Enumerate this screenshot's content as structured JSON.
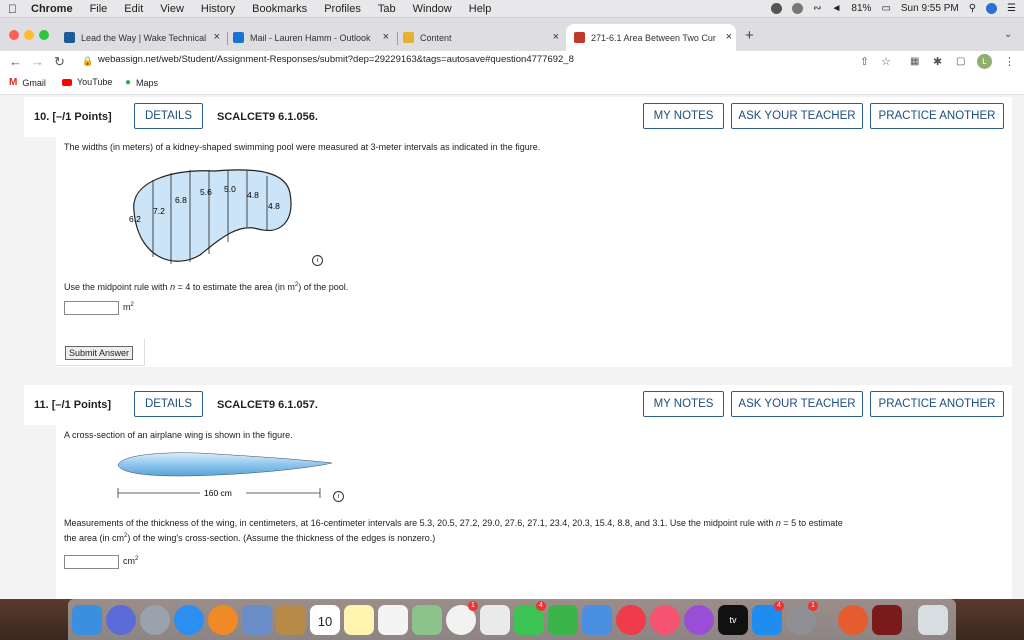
{
  "menubar": {
    "app": "Chrome",
    "items": [
      "File",
      "Edit",
      "View",
      "History",
      "Bookmarks",
      "Profiles",
      "Tab",
      "Window",
      "Help"
    ],
    "battery": "81%",
    "clock": "Sun 9:55 PM"
  },
  "tabs": [
    {
      "label": "Lead the Way | Wake Technical",
      "icon_color": "#1c5a9c"
    },
    {
      "label": "Mail - Lauren Hamm - Outlook",
      "icon_color": "#1b73d1"
    },
    {
      "label": "Content",
      "icon_color": "#e6b12e"
    },
    {
      "label": "271-6.1 Area Between Two Cur",
      "icon_color": "#c0392b"
    }
  ],
  "toolbar": {
    "url": "webassign.net/web/Student/Assignment-Responses/submit?dep=29229163&tags=autosave#question4777692_8",
    "profile_initial": "L"
  },
  "bookmarks": [
    {
      "label": "Gmail",
      "icon_color": "#d93025"
    },
    {
      "label": "YouTube",
      "icon_color": "#ff0000"
    },
    {
      "label": "Maps",
      "icon_color": "#34a853"
    }
  ],
  "q10": {
    "number": "10.",
    "points": "[–/1 Points]",
    "details": "DETAILS",
    "id": "SCALCET9 6.1.056.",
    "my_notes": "MY NOTES",
    "ask_teacher": "ASK YOUR TEACHER",
    "practice": "PRACTICE ANOTHER",
    "text": "The widths (in meters) of a kidney-shaped swimming pool were measured at 3-meter intervals as indicated in the figure.",
    "widths": [
      "6.2",
      "7.2",
      "6.8",
      "5.6",
      "5.0",
      "4.8",
      "4.8"
    ],
    "instruction_pre": "Use the midpoint rule with ",
    "n_var": "n",
    "instruction_mid": " = 4 to estimate the area (in m",
    "instruction_post": ") of the pool.",
    "unit": "m",
    "exp": "2",
    "submit": "Submit Answer"
  },
  "q11": {
    "number": "11.",
    "points": "[–/1 Points]",
    "details": "DETAILS",
    "id": "SCALCET9 6.1.057.",
    "my_notes": "MY NOTES",
    "ask_teacher": "ASK YOUR TEACHER",
    "practice": "PRACTICE ANOTHER",
    "text": "A cross-section of an airplane wing is shown in the figure.",
    "dimension": "160 cm",
    "measure_line1_pre": "Measurements of the thickness of the wing, in centimeters, at 16-centimeter intervals are 5.3, 20.5, 27.2, 29.0, 27.6, 27.1, 23.4, 20.3, 15.4, 8.8, and 3.1. Use the midpoint rule with ",
    "n_var": "n",
    "measure_line1_post": " = 5 to estimate",
    "measure_line2_pre": "the area (in cm",
    "measure_line2_post": ") of the wing's cross-section. (Assume the thickness of the edges is nonzero.)",
    "unit": "cm",
    "exp": "2"
  },
  "dock": {
    "calendar_date": "10",
    "badges": [
      "1",
      "4",
      "4",
      "1"
    ]
  },
  "colors": {
    "accent": "#1d4e7f",
    "pool_fill": "#cce4f7",
    "wing_fill": "#8fc6ee"
  }
}
